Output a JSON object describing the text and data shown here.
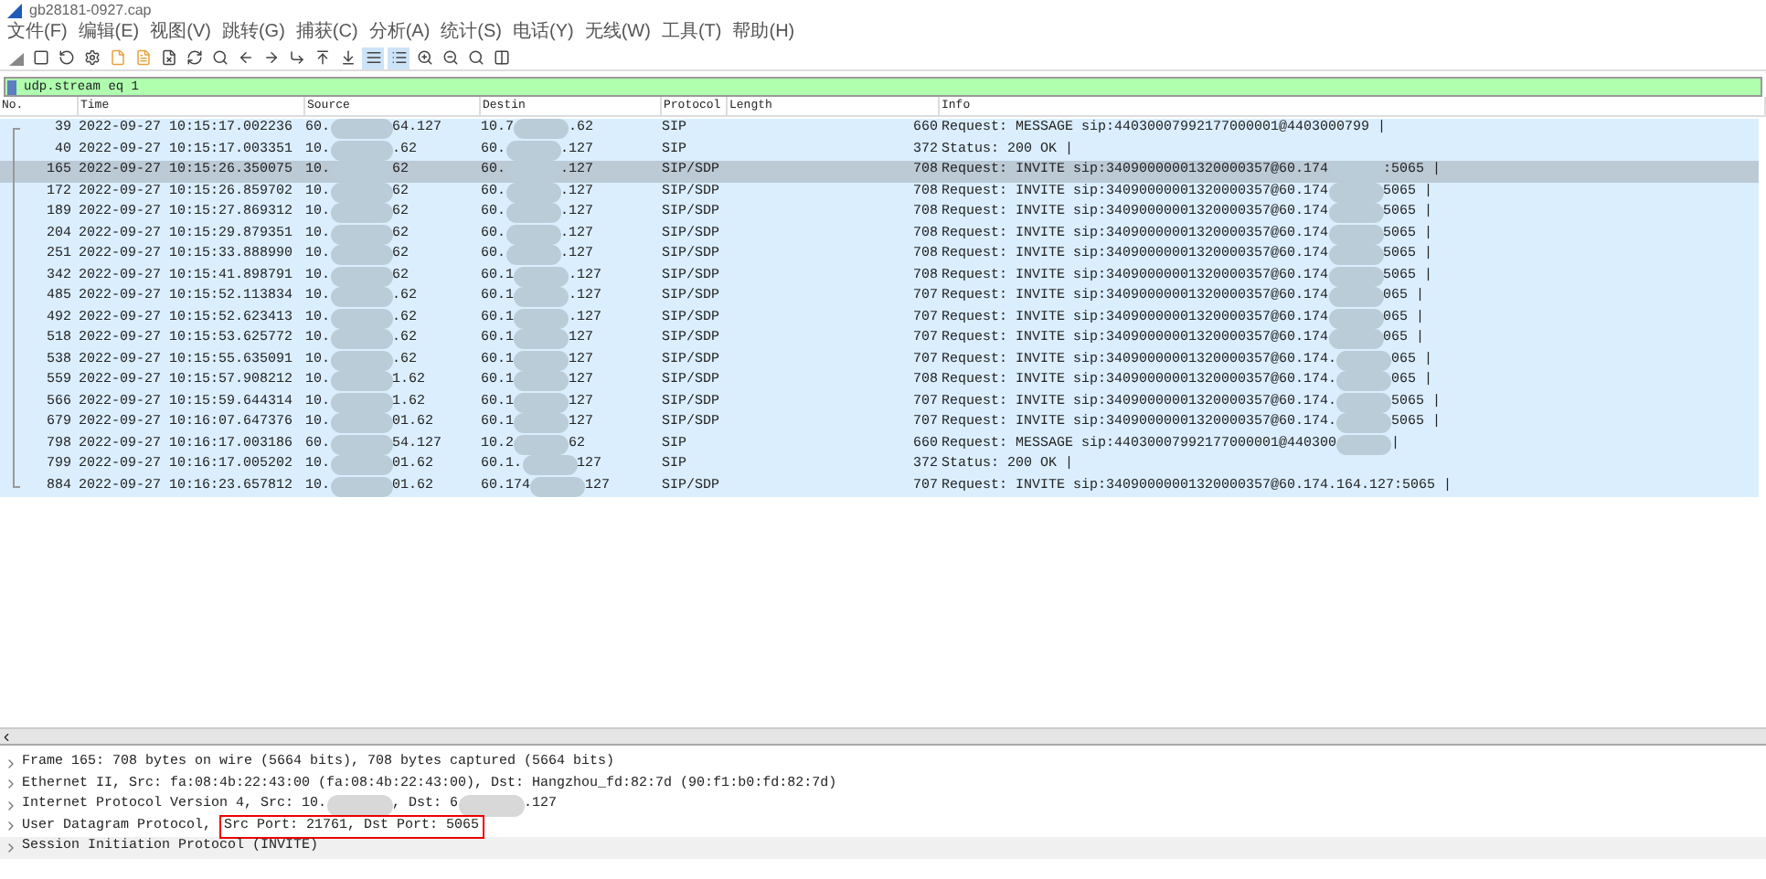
{
  "window": {
    "title": "gb28181-0927.cap"
  },
  "menu": [
    "文件(F)",
    "编辑(E)",
    "视图(V)",
    "跳转(G)",
    "捕获(C)",
    "分析(A)",
    "统计(S)",
    "电话(Y)",
    "无线(W)",
    "工具(T)",
    "帮助(H)"
  ],
  "filter": {
    "value": "udp.stream eq 1"
  },
  "columns": [
    "No.",
    "Time",
    "Source",
    "Destin",
    "Protocol",
    "Length",
    "Info"
  ],
  "rows": [
    {
      "no": "39",
      "time": "2022-09-27 10:15:17.002236",
      "source": [
        "60.",
        "64.127"
      ],
      "destination": [
        "10.7",
        ".62"
      ],
      "protocol": "SIP",
      "length": "660",
      "info": [
        "Request: MESSAGE sip:44030007992177000001@4403000799 |"
      ],
      "selected": false
    },
    {
      "no": "40",
      "time": "2022-09-27 10:15:17.003351",
      "source": [
        "10.",
        ".62"
      ],
      "destination": [
        "60.",
        ".127"
      ],
      "protocol": "SIP",
      "length": "372",
      "info": [
        "Status: 200 OK |"
      ],
      "selected": false
    },
    {
      "no": "165",
      "time": "2022-09-27 10:15:26.350075",
      "source": [
        "10.",
        "62"
      ],
      "destination": [
        "60.",
        ".127"
      ],
      "protocol": "SIP/SDP",
      "length": "708",
      "info": [
        "Request: INVITE sip:34090000001320000357@60.174",
        ":5065 |"
      ],
      "selected": true
    },
    {
      "no": "172",
      "time": "2022-09-27 10:15:26.859702",
      "source": [
        "10.",
        "62"
      ],
      "destination": [
        "60.",
        ".127"
      ],
      "protocol": "SIP/SDP",
      "length": "708",
      "info": [
        "Request: INVITE sip:34090000001320000357@60.174",
        "5065 |"
      ],
      "selected": false
    },
    {
      "no": "189",
      "time": "2022-09-27 10:15:27.869312",
      "source": [
        "10.",
        "62"
      ],
      "destination": [
        "60.",
        ".127"
      ],
      "protocol": "SIP/SDP",
      "length": "708",
      "info": [
        "Request: INVITE sip:34090000001320000357@60.174",
        "5065 |"
      ],
      "selected": false
    },
    {
      "no": "204",
      "time": "2022-09-27 10:15:29.879351",
      "source": [
        "10.",
        "62"
      ],
      "destination": [
        "60.",
        ".127"
      ],
      "protocol": "SIP/SDP",
      "length": "708",
      "info": [
        "Request: INVITE sip:34090000001320000357@60.174",
        "5065 |"
      ],
      "selected": false
    },
    {
      "no": "251",
      "time": "2022-09-27 10:15:33.888990",
      "source": [
        "10.",
        "62"
      ],
      "destination": [
        "60.",
        ".127"
      ],
      "protocol": "SIP/SDP",
      "length": "708",
      "info": [
        "Request: INVITE sip:34090000001320000357@60.174",
        "5065 |"
      ],
      "selected": false
    },
    {
      "no": "342",
      "time": "2022-09-27 10:15:41.898791",
      "source": [
        "10.",
        "62"
      ],
      "destination": [
        "60.1",
        ".127"
      ],
      "protocol": "SIP/SDP",
      "length": "708",
      "info": [
        "Request: INVITE sip:34090000001320000357@60.174",
        "5065 |"
      ],
      "selected": false
    },
    {
      "no": "485",
      "time": "2022-09-27 10:15:52.113834",
      "source": [
        "10.",
        ".62"
      ],
      "destination": [
        "60.1",
        ".127"
      ],
      "protocol": "SIP/SDP",
      "length": "707",
      "info": [
        "Request: INVITE sip:34090000001320000357@60.174",
        "065 |"
      ],
      "selected": false
    },
    {
      "no": "492",
      "time": "2022-09-27 10:15:52.623413",
      "source": [
        "10.",
        ".62"
      ],
      "destination": [
        "60.1",
        ".127"
      ],
      "protocol": "SIP/SDP",
      "length": "707",
      "info": [
        "Request: INVITE sip:34090000001320000357@60.174",
        "065 |"
      ],
      "selected": false
    },
    {
      "no": "518",
      "time": "2022-09-27 10:15:53.625772",
      "source": [
        "10.",
        ".62"
      ],
      "destination": [
        "60.1",
        "127"
      ],
      "protocol": "SIP/SDP",
      "length": "707",
      "info": [
        "Request: INVITE sip:34090000001320000357@60.174",
        "065 |"
      ],
      "selected": false
    },
    {
      "no": "538",
      "time": "2022-09-27 10:15:55.635091",
      "source": [
        "10.",
        ".62"
      ],
      "destination": [
        "60.1",
        "127"
      ],
      "protocol": "SIP/SDP",
      "length": "707",
      "info": [
        "Request: INVITE sip:34090000001320000357@60.174.",
        "065 |"
      ],
      "selected": false
    },
    {
      "no": "559",
      "time": "2022-09-27 10:15:57.908212",
      "source": [
        "10.",
        "1.62"
      ],
      "destination": [
        "60.1",
        "127"
      ],
      "protocol": "SIP/SDP",
      "length": "708",
      "info": [
        "Request: INVITE sip:34090000001320000357@60.174.",
        "065 |"
      ],
      "selected": false
    },
    {
      "no": "566",
      "time": "2022-09-27 10:15:59.644314",
      "source": [
        "10.",
        "1.62"
      ],
      "destination": [
        "60.1",
        "127"
      ],
      "protocol": "SIP/SDP",
      "length": "707",
      "info": [
        "Request: INVITE sip:34090000001320000357@60.174.",
        "5065 |"
      ],
      "selected": false
    },
    {
      "no": "679",
      "time": "2022-09-27 10:16:07.647376",
      "source": [
        "10.",
        "01.62"
      ],
      "destination": [
        "60.1",
        "127"
      ],
      "protocol": "SIP/SDP",
      "length": "707",
      "info": [
        "Request: INVITE sip:34090000001320000357@60.174.",
        "5065 |"
      ],
      "selected": false
    },
    {
      "no": "798",
      "time": "2022-09-27 10:16:17.003186",
      "source": [
        "60.",
        "54.127"
      ],
      "destination": [
        "10.2",
        "62"
      ],
      "protocol": "SIP",
      "length": "660",
      "info": [
        "Request: MESSAGE sip:44030007992177000001@440300",
        "|"
      ],
      "selected": false
    },
    {
      "no": "799",
      "time": "2022-09-27 10:16:17.005202",
      "source": [
        "10.",
        "01.62"
      ],
      "destination": [
        "60.1.",
        "127"
      ],
      "protocol": "SIP",
      "length": "372",
      "info": [
        "Status: 200 OK |"
      ],
      "selected": false
    },
    {
      "no": "884",
      "time": "2022-09-27 10:16:23.657812",
      "source": [
        "10.",
        "01.62"
      ],
      "destination": [
        "60.174",
        "127"
      ],
      "protocol": "SIP/SDP",
      "length": "707",
      "info": [
        "Request: INVITE sip:34090000001320000357@60.174.164.127:5065 |"
      ],
      "selected": false
    }
  ],
  "details": [
    {
      "parts": [
        "Frame 165: 708 bytes on wire (5664 bits), 708 bytes captured (5664 bits)"
      ],
      "selected": false
    },
    {
      "parts": [
        "Ethernet II, Src: fa:08:4b:22:43:00 (fa:08:4b:22:43:00), Dst: Hangzhou_fd:82:7d (90:f1:b0:fd:82:7d)"
      ],
      "selected": false
    },
    {
      "parts": [
        "Internet Protocol Version 4, Src: 10.",
        ", Dst: 6",
        ".127"
      ],
      "selected": false
    },
    {
      "parts": [
        "User Datagram Protocol,"
      ],
      "boxed": "Src Port: 21761, Dst Port: 5065",
      "selected": false
    },
    {
      "parts": [
        "Session Initiation Protocol (INVITE)"
      ],
      "selected": true
    }
  ]
}
